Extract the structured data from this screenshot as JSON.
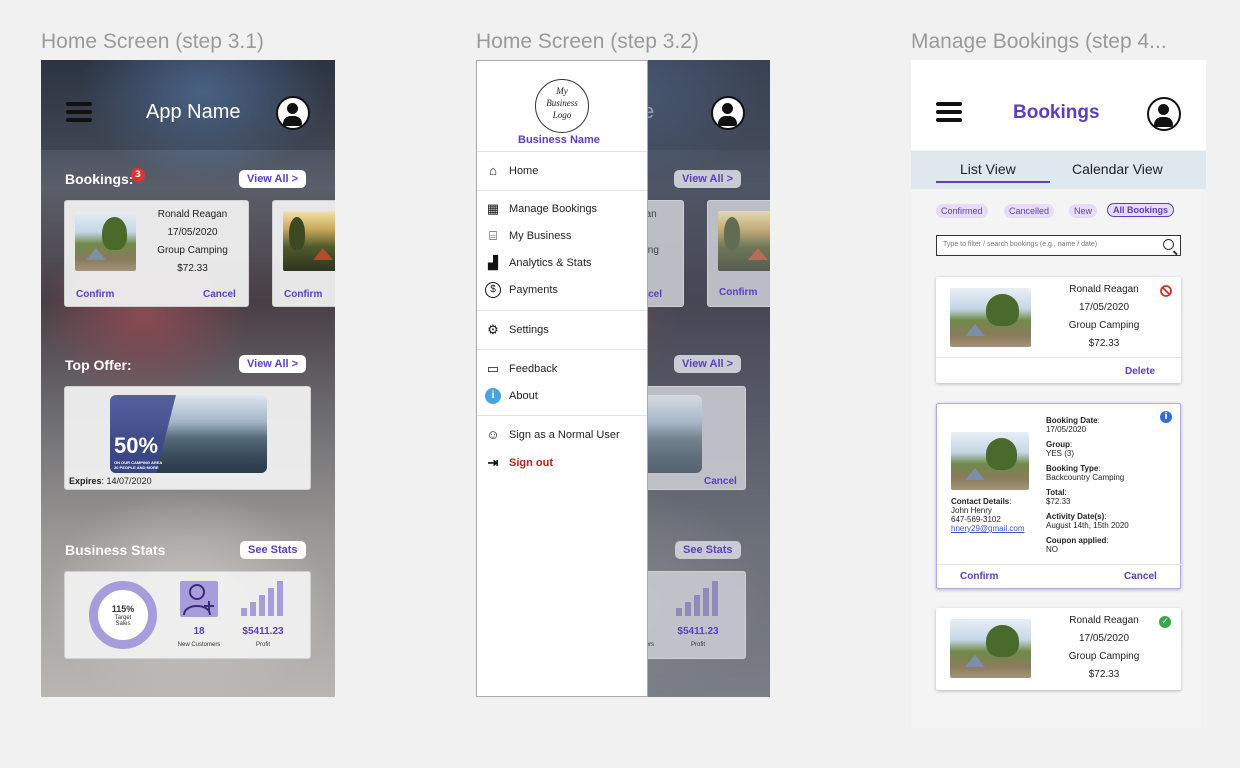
{
  "frames": {
    "f1_title": "Home Screen (step 3.1)",
    "f2_title": "Home Screen (step 3.2)",
    "f3_title": "Manage Bookings (step 4..."
  },
  "home": {
    "app_name": "App Name",
    "bookings_label": "Bookings:",
    "bookings_badge": "3",
    "view_all": "View All >",
    "booking": {
      "name": "Ronald Reagan",
      "date": "17/05/2020",
      "type": "Group Camping",
      "price": "$72.33",
      "confirm": "Confirm",
      "cancel": "Cancel"
    },
    "second_confirm": "Confirm",
    "top_offer_label": "Top Offer:",
    "offer_big": "50%",
    "offer_small_1": "ON OUR CAMPING AREA",
    "offer_small_2": "20 PEOPLE AND MORE",
    "expires_label": "Expires",
    "expires_value": ": 14/07/2020",
    "stats_label": "Business Stats",
    "see_stats": "See Stats",
    "target_pct": "115%",
    "target_lbl1": "Target",
    "target_lbl2": "Sales",
    "target_progress": 1.15,
    "new_customers": "18",
    "new_customers_lbl": "New Customers",
    "profit": "$5411.23",
    "profit_lbl": "Profit"
  },
  "drawer": {
    "logo_line1": "My",
    "logo_line2": "Business",
    "logo_line3": "Logo",
    "business_name": "Business Name",
    "items": [
      {
        "label": "Home",
        "icon": "home-icon",
        "glyph": "⌂"
      },
      {
        "label": "Manage Bookings",
        "icon": "calendar-icon",
        "glyph": "▦"
      },
      {
        "label": "My Business",
        "icon": "store-icon",
        "glyph": "⌸"
      },
      {
        "label": "Analytics & Stats",
        "icon": "chart-icon",
        "glyph": "▟"
      },
      {
        "label": "Payments",
        "icon": "dollar-icon",
        "glyph": "$"
      },
      {
        "label": "Settings",
        "icon": "gear-icon",
        "glyph": "⚙"
      },
      {
        "label": "Feedback",
        "icon": "feedback-icon",
        "glyph": "▭"
      },
      {
        "label": "About",
        "icon": "info-icon",
        "glyph": "i"
      },
      {
        "label": "Sign as a Normal User",
        "icon": "user-switch-icon",
        "glyph": "☺"
      },
      {
        "label": "Sign out",
        "icon": "sign-out-icon",
        "glyph": "⇥"
      }
    ],
    "bg_view_all_1": "View All >",
    "bg_view_all_2": "View All >",
    "bg_see_stats": "See Stats",
    "bg_cancel": "Cancel",
    "bg_confirm": "Confirm",
    "bg_cancel2": "ncel",
    "bg_profit": "$5411.23",
    "bg_profit_lbl": "Profit",
    "bg_customers_lbl": "ers",
    "bg_text_1": "gan",
    "bg_text_2": "0",
    "bg_text_3": "ping",
    "bg_app_frag": "e"
  },
  "bookings": {
    "title": "Bookings",
    "tab_list": "List View",
    "tab_calendar": "Calendar View",
    "chips": [
      "Confirmed",
      "Cancelled",
      "New",
      "All Bookings"
    ],
    "search_placeholder": "Type to filter / search bookings (e.g., name / date)",
    "card1": {
      "name": "Ronald Reagan",
      "date": "17/05/2020",
      "type": "Group Camping",
      "price": "$72.33",
      "action": "Delete"
    },
    "card2": {
      "booking_date_lbl": "Booking Date",
      "booking_date": "17/05/2020",
      "group_lbl": "Group",
      "group": "YES (3)",
      "booking_type_lbl": "Booking Type",
      "booking_type": "Backcountry Camping",
      "total_lbl": "Total",
      "total": "$72.33",
      "activity_lbl": "Activity Date(s)",
      "activity": "August 14th, 15th 2020",
      "coupon_lbl": "Coupon applied",
      "coupon": "NO",
      "contact_lbl": "Contact Details",
      "contact_name": "John Henry",
      "contact_phone": "647-569-3102",
      "contact_email": "hnery29@gmail.com",
      "confirm": "Confirm",
      "cancel": "Cancel"
    },
    "card3": {
      "name": "Ronald Reagan",
      "date": "17/05/2020",
      "type": "Group Camping",
      "price": "$72.33"
    }
  },
  "colors": {
    "accent": "#5b3ec4",
    "danger": "#c0201b",
    "success": "#3aa64a",
    "info": "#2f6fd6"
  }
}
